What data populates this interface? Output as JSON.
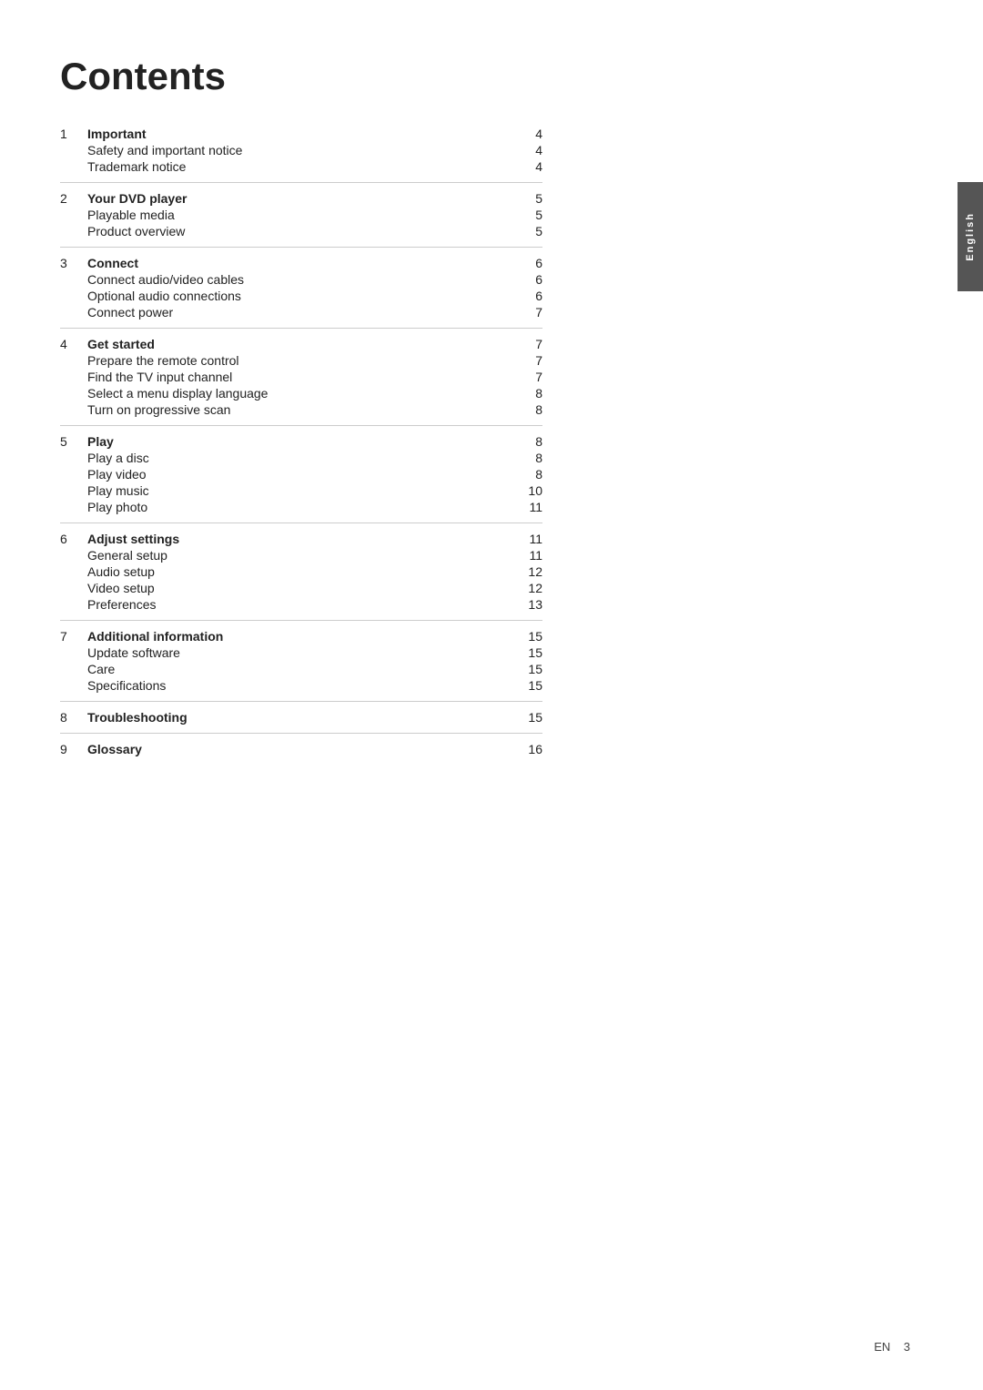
{
  "page": {
    "title": "Contents",
    "footer": "EN",
    "footer_page": "3",
    "sidebar_label": "English"
  },
  "sections": [
    {
      "number": "1",
      "title": "Important",
      "page": "4",
      "items": [
        {
          "label": "Safety and important notice",
          "page": "4"
        },
        {
          "label": "Trademark notice",
          "page": "4"
        }
      ]
    },
    {
      "number": "2",
      "title": "Your DVD player",
      "page": "5",
      "items": [
        {
          "label": "Playable media",
          "page": "5"
        },
        {
          "label": "Product overview",
          "page": "5"
        }
      ]
    },
    {
      "number": "3",
      "title": "Connect",
      "page": "6",
      "items": [
        {
          "label": "Connect audio/video cables",
          "page": "6"
        },
        {
          "label": "Optional audio connections",
          "page": "6"
        },
        {
          "label": "Connect power",
          "page": "7"
        }
      ]
    },
    {
      "number": "4",
      "title": "Get started",
      "page": "7",
      "items": [
        {
          "label": "Prepare the remote control",
          "page": "7"
        },
        {
          "label": "Find the TV input channel",
          "page": "7"
        },
        {
          "label": "Select a menu display language",
          "page": "8"
        },
        {
          "label": "Turn on progressive scan",
          "page": "8"
        }
      ]
    },
    {
      "number": "5",
      "title": "Play",
      "page": "8",
      "items": [
        {
          "label": "Play a disc",
          "page": "8"
        },
        {
          "label": "Play video",
          "page": "8"
        },
        {
          "label": "Play music",
          "page": "10"
        },
        {
          "label": "Play photo",
          "page": "11"
        }
      ]
    },
    {
      "number": "6",
      "title": "Adjust settings",
      "page": "11",
      "items": [
        {
          "label": "General setup",
          "page": "11"
        },
        {
          "label": "Audio setup",
          "page": "12"
        },
        {
          "label": "Video setup",
          "page": "12"
        },
        {
          "label": "Preferences",
          "page": "13"
        }
      ]
    },
    {
      "number": "7",
      "title": "Additional information",
      "page": "15",
      "items": [
        {
          "label": "Update software",
          "page": "15"
        },
        {
          "label": "Care",
          "page": "15"
        },
        {
          "label": "Specifications",
          "page": "15"
        }
      ]
    },
    {
      "number": "8",
      "title": "Troubleshooting",
      "page": "15",
      "items": []
    },
    {
      "number": "9",
      "title": "Glossary",
      "page": "16",
      "items": []
    }
  ]
}
